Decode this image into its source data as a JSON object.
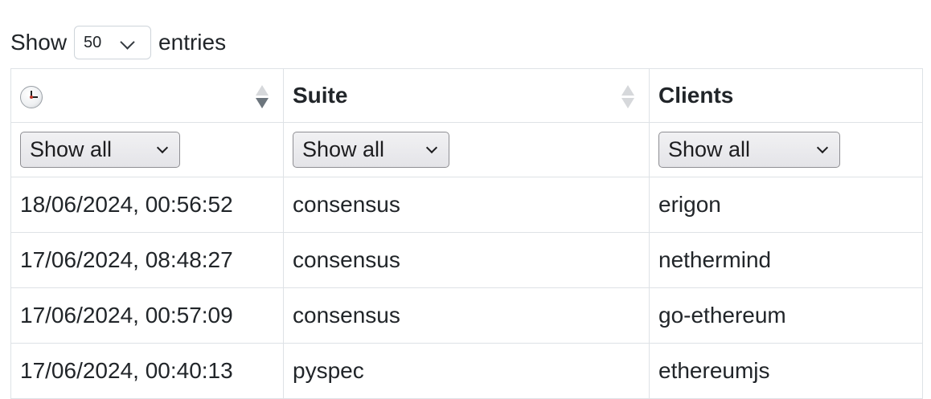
{
  "length": {
    "prefix": "Show",
    "selected": "50",
    "suffix": "entries"
  },
  "icons": {
    "time_header": "clock-icon"
  },
  "columns": {
    "time": "",
    "suite": "Suite",
    "clients": "Clients"
  },
  "filters": {
    "time": "Show all",
    "suite": "Show all",
    "clients": "Show all"
  },
  "rows": [
    {
      "time": "18/06/2024, 00:56:52",
      "suite": "consensus",
      "clients": "erigon"
    },
    {
      "time": "17/06/2024, 08:48:27",
      "suite": "consensus",
      "clients": "nethermind"
    },
    {
      "time": "17/06/2024, 00:57:09",
      "suite": "consensus",
      "clients": "go-ethereum"
    },
    {
      "time": "17/06/2024, 00:40:13",
      "suite": "pyspec",
      "clients": "ethereumjs"
    }
  ],
  "colors": {
    "text": "#212529",
    "border": "#dee2e6"
  }
}
